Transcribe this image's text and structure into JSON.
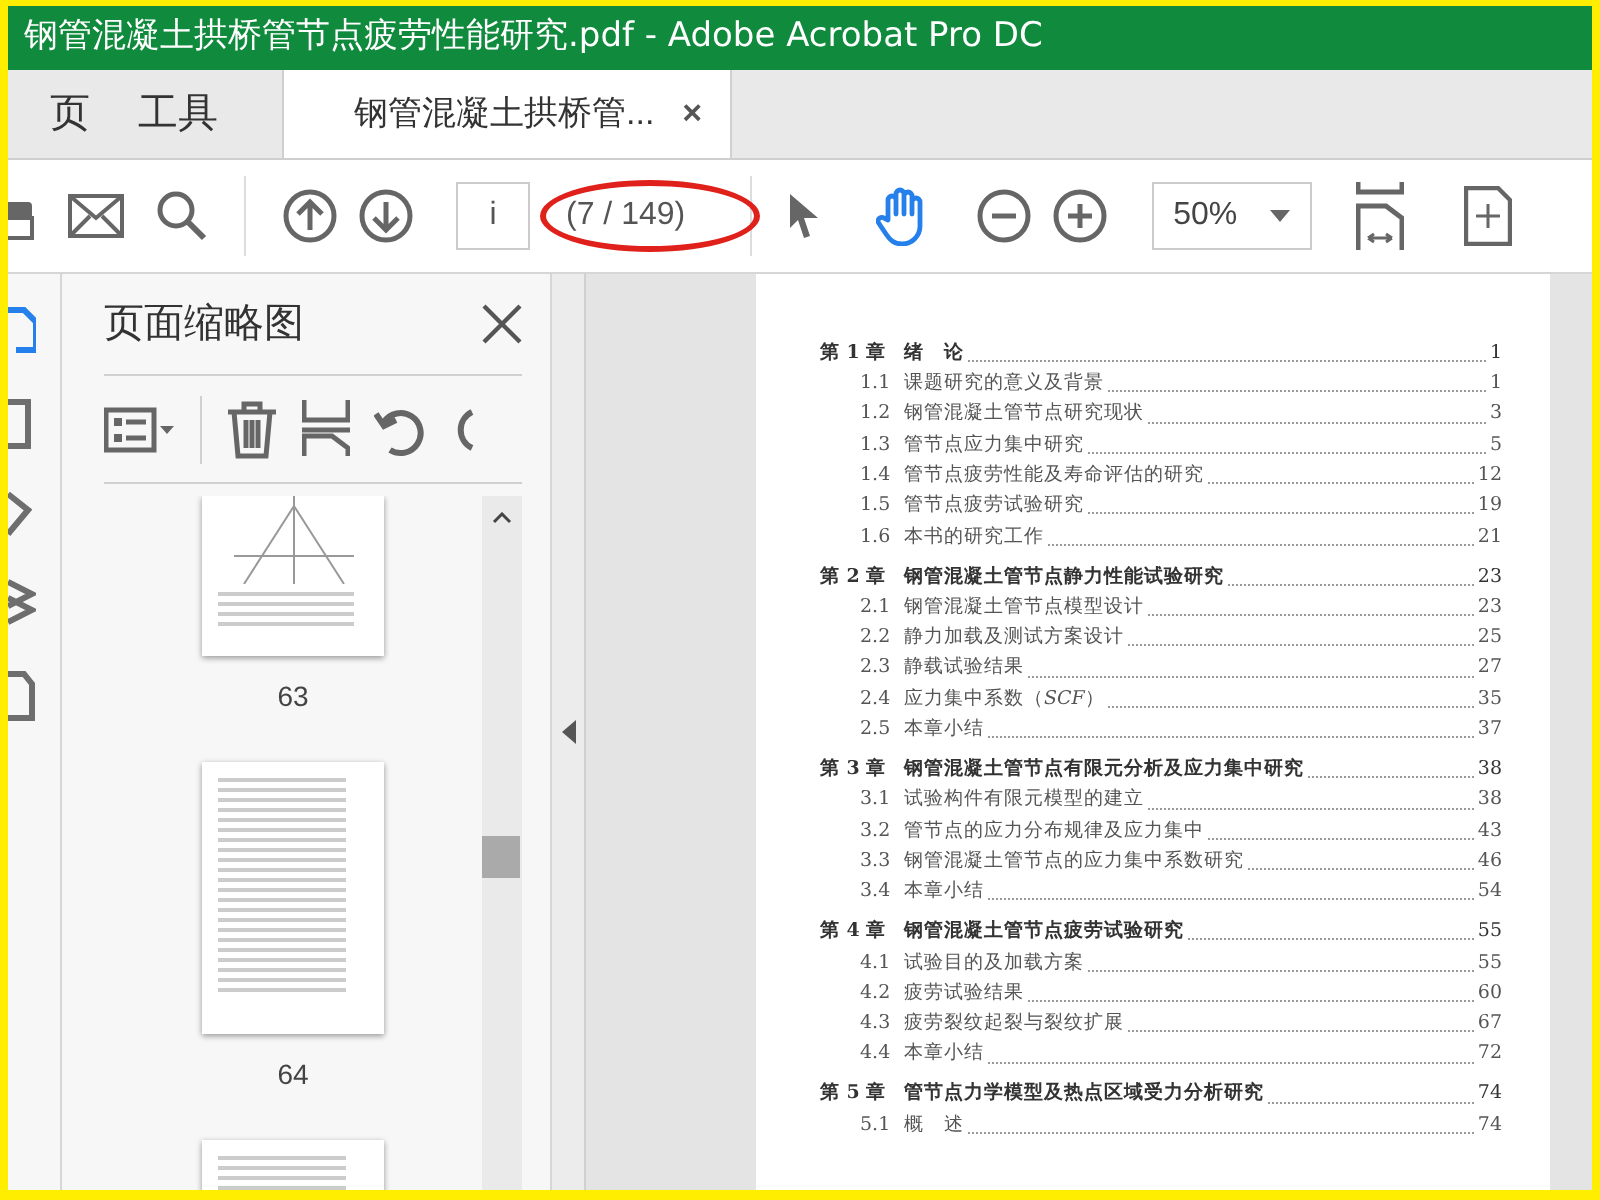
{
  "window": {
    "title": "钢管混凝土拱桥管节点疲劳性能研究.pdf - Adobe Acrobat Pro DC"
  },
  "tabs": [
    {
      "label": "页",
      "selected": false
    },
    {
      "label": "工具",
      "selected": false
    },
    {
      "label": "钢管混凝土拱桥管...",
      "selected": true,
      "close": "×"
    }
  ],
  "toolbar": {
    "page_field": {
      "value": "i"
    },
    "page_count": "(7 / 149)",
    "highlighted": true,
    "tools": [
      {
        "kind": "select",
        "selected": false
      },
      {
        "kind": "hand",
        "selected": true
      }
    ],
    "zoom": {
      "value": "50%"
    }
  },
  "sidebar": {
    "title": "页面缩略图",
    "thumbnails": [
      {
        "page": "63",
        "kind": "figure"
      },
      {
        "page": "64",
        "kind": "table"
      }
    ]
  },
  "toc": [
    {
      "number": "第 1 章",
      "title": "绪　论",
      "page": "1",
      "children": [
        {
          "number": "1.1",
          "title": "课题研究的意义及背景",
          "page": "1"
        },
        {
          "number": "1.2",
          "title": "钢管混凝土管节点研究现状",
          "page": "3"
        },
        {
          "number": "1.3",
          "title": "管节点应力集中研究",
          "page": "5"
        },
        {
          "number": "1.4",
          "title": "管节点疲劳性能及寿命评估的研究",
          "page": "12"
        },
        {
          "number": "1.5",
          "title": "管节点疲劳试验研究",
          "page": "19"
        },
        {
          "number": "1.6",
          "title": "本书的研究工作",
          "page": "21"
        }
      ]
    },
    {
      "number": "第 2 章",
      "title": "钢管混凝土管节点静力性能试验研究",
      "page": "23",
      "children": [
        {
          "number": "2.1",
          "title": "钢管混凝土管节点模型设计",
          "page": "23"
        },
        {
          "number": "2.2",
          "title": "静力加载及测试方案设计",
          "page": "25"
        },
        {
          "number": "2.3",
          "title": "静载试验结果",
          "page": "27"
        },
        {
          "number": "2.4",
          "title": "应力集中系数（*SCF*）",
          "page": "35"
        },
        {
          "number": "2.5",
          "title": "本章小结",
          "page": "37"
        }
      ]
    },
    {
      "number": "第 3 章",
      "title": "钢管混凝土管节点有限元分析及应力集中研究",
      "page": "38",
      "children": [
        {
          "number": "3.1",
          "title": "试验构件有限元模型的建立",
          "page": "38"
        },
        {
          "number": "3.2",
          "title": "管节点的应力分布规律及应力集中",
          "page": "43"
        },
        {
          "number": "3.3",
          "title": "钢管混凝土管节点的应力集中系数研究",
          "page": "46"
        },
        {
          "number": "3.4",
          "title": "本章小结",
          "page": "54"
        }
      ]
    },
    {
      "number": "第 4 章",
      "title": "钢管混凝土管节点疲劳试验研究",
      "page": "55",
      "children": [
        {
          "number": "4.1",
          "title": "试验目的及加载方案",
          "page": "55"
        },
        {
          "number": "4.2",
          "title": "疲劳试验结果",
          "page": "60"
        },
        {
          "number": "4.3",
          "title": "疲劳裂纹起裂与裂纹扩展",
          "page": "67"
        },
        {
          "number": "4.4",
          "title": "本章小结",
          "page": "72"
        }
      ]
    },
    {
      "number": "第 5 章",
      "title": "管节点力学模型及热点区域受力分析研究",
      "page": "74",
      "children": [
        {
          "number": "5.1",
          "title": "概　述",
          "page": "74"
        }
      ]
    }
  ]
}
